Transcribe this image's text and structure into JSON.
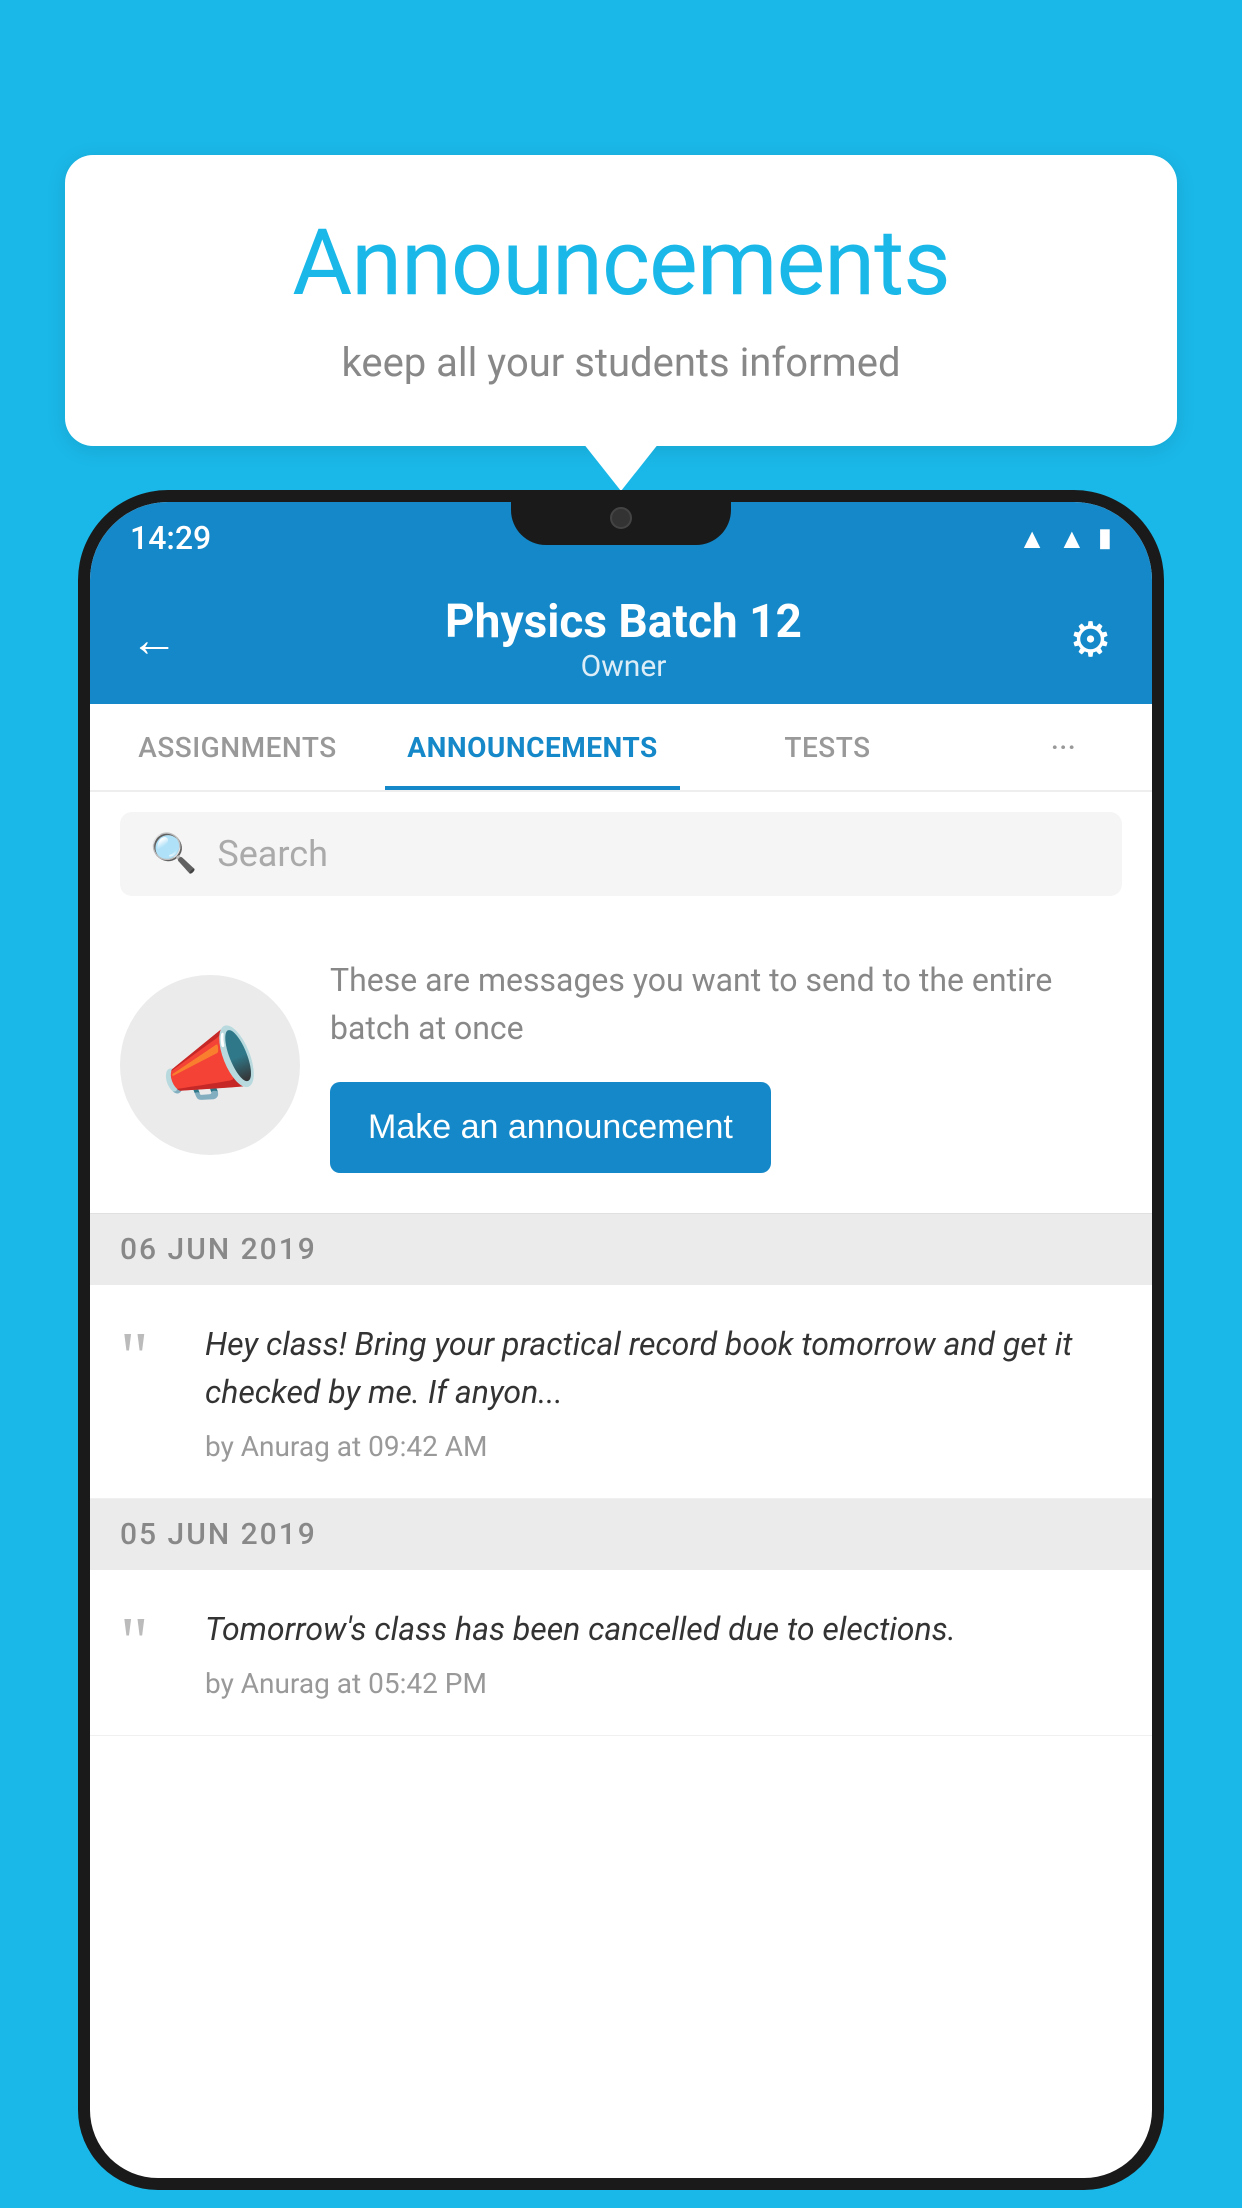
{
  "background_color": "#1ab8e8",
  "speech_bubble": {
    "title": "Announcements",
    "subtitle": "keep all your students informed"
  },
  "phone": {
    "status_bar": {
      "time": "14:29"
    },
    "header": {
      "title": "Physics Batch 12",
      "subtitle": "Owner",
      "back_label": "←",
      "settings_label": "⚙"
    },
    "tabs": [
      {
        "label": "ASSIGNMENTS",
        "active": false
      },
      {
        "label": "ANNOUNCEMENTS",
        "active": true
      },
      {
        "label": "TESTS",
        "active": false
      },
      {
        "label": "···",
        "active": false,
        "narrow": true
      }
    ],
    "search": {
      "placeholder": "Search"
    },
    "announcement_prompt": {
      "description": "These are messages you want to send to the entire batch at once",
      "button_label": "Make an announcement"
    },
    "date_groups": [
      {
        "date": "06  JUN  2019",
        "announcements": [
          {
            "message": "Hey class! Bring your practical record book tomorrow and get it checked by me. If anyon...",
            "meta": "by Anurag at 09:42 AM"
          }
        ]
      },
      {
        "date": "05  JUN  2019",
        "announcements": [
          {
            "message": "Tomorrow's class has been cancelled due to elections.",
            "meta": "by Anurag at 05:42 PM"
          }
        ]
      }
    ]
  }
}
